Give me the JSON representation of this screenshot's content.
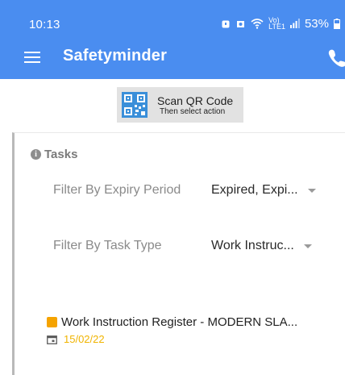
{
  "status_bar": {
    "time": "10:13",
    "signal_label_top": "Vo)",
    "signal_label_bottom": "LTE1",
    "battery": "53%"
  },
  "app_bar": {
    "title": "Safetyminder",
    "menu_icon": "hamburger-menu-icon",
    "phone_icon": "phone-icon",
    "color": "#4a8df0"
  },
  "scan": {
    "label": "Scan QR Code",
    "sublabel": "Then select action",
    "icon": "qr-code-icon"
  },
  "tasks": {
    "title": "Tasks",
    "filters": [
      {
        "label": "Filter By Expiry Period",
        "value": "Expired, Expi..."
      },
      {
        "label": "Filter By Task Type",
        "value": "Work Instruc..."
      }
    ],
    "items": [
      {
        "title": "Work Instruction Register - MODERN SLA...",
        "date": "15/02/22",
        "color": "#f5a300"
      }
    ]
  }
}
